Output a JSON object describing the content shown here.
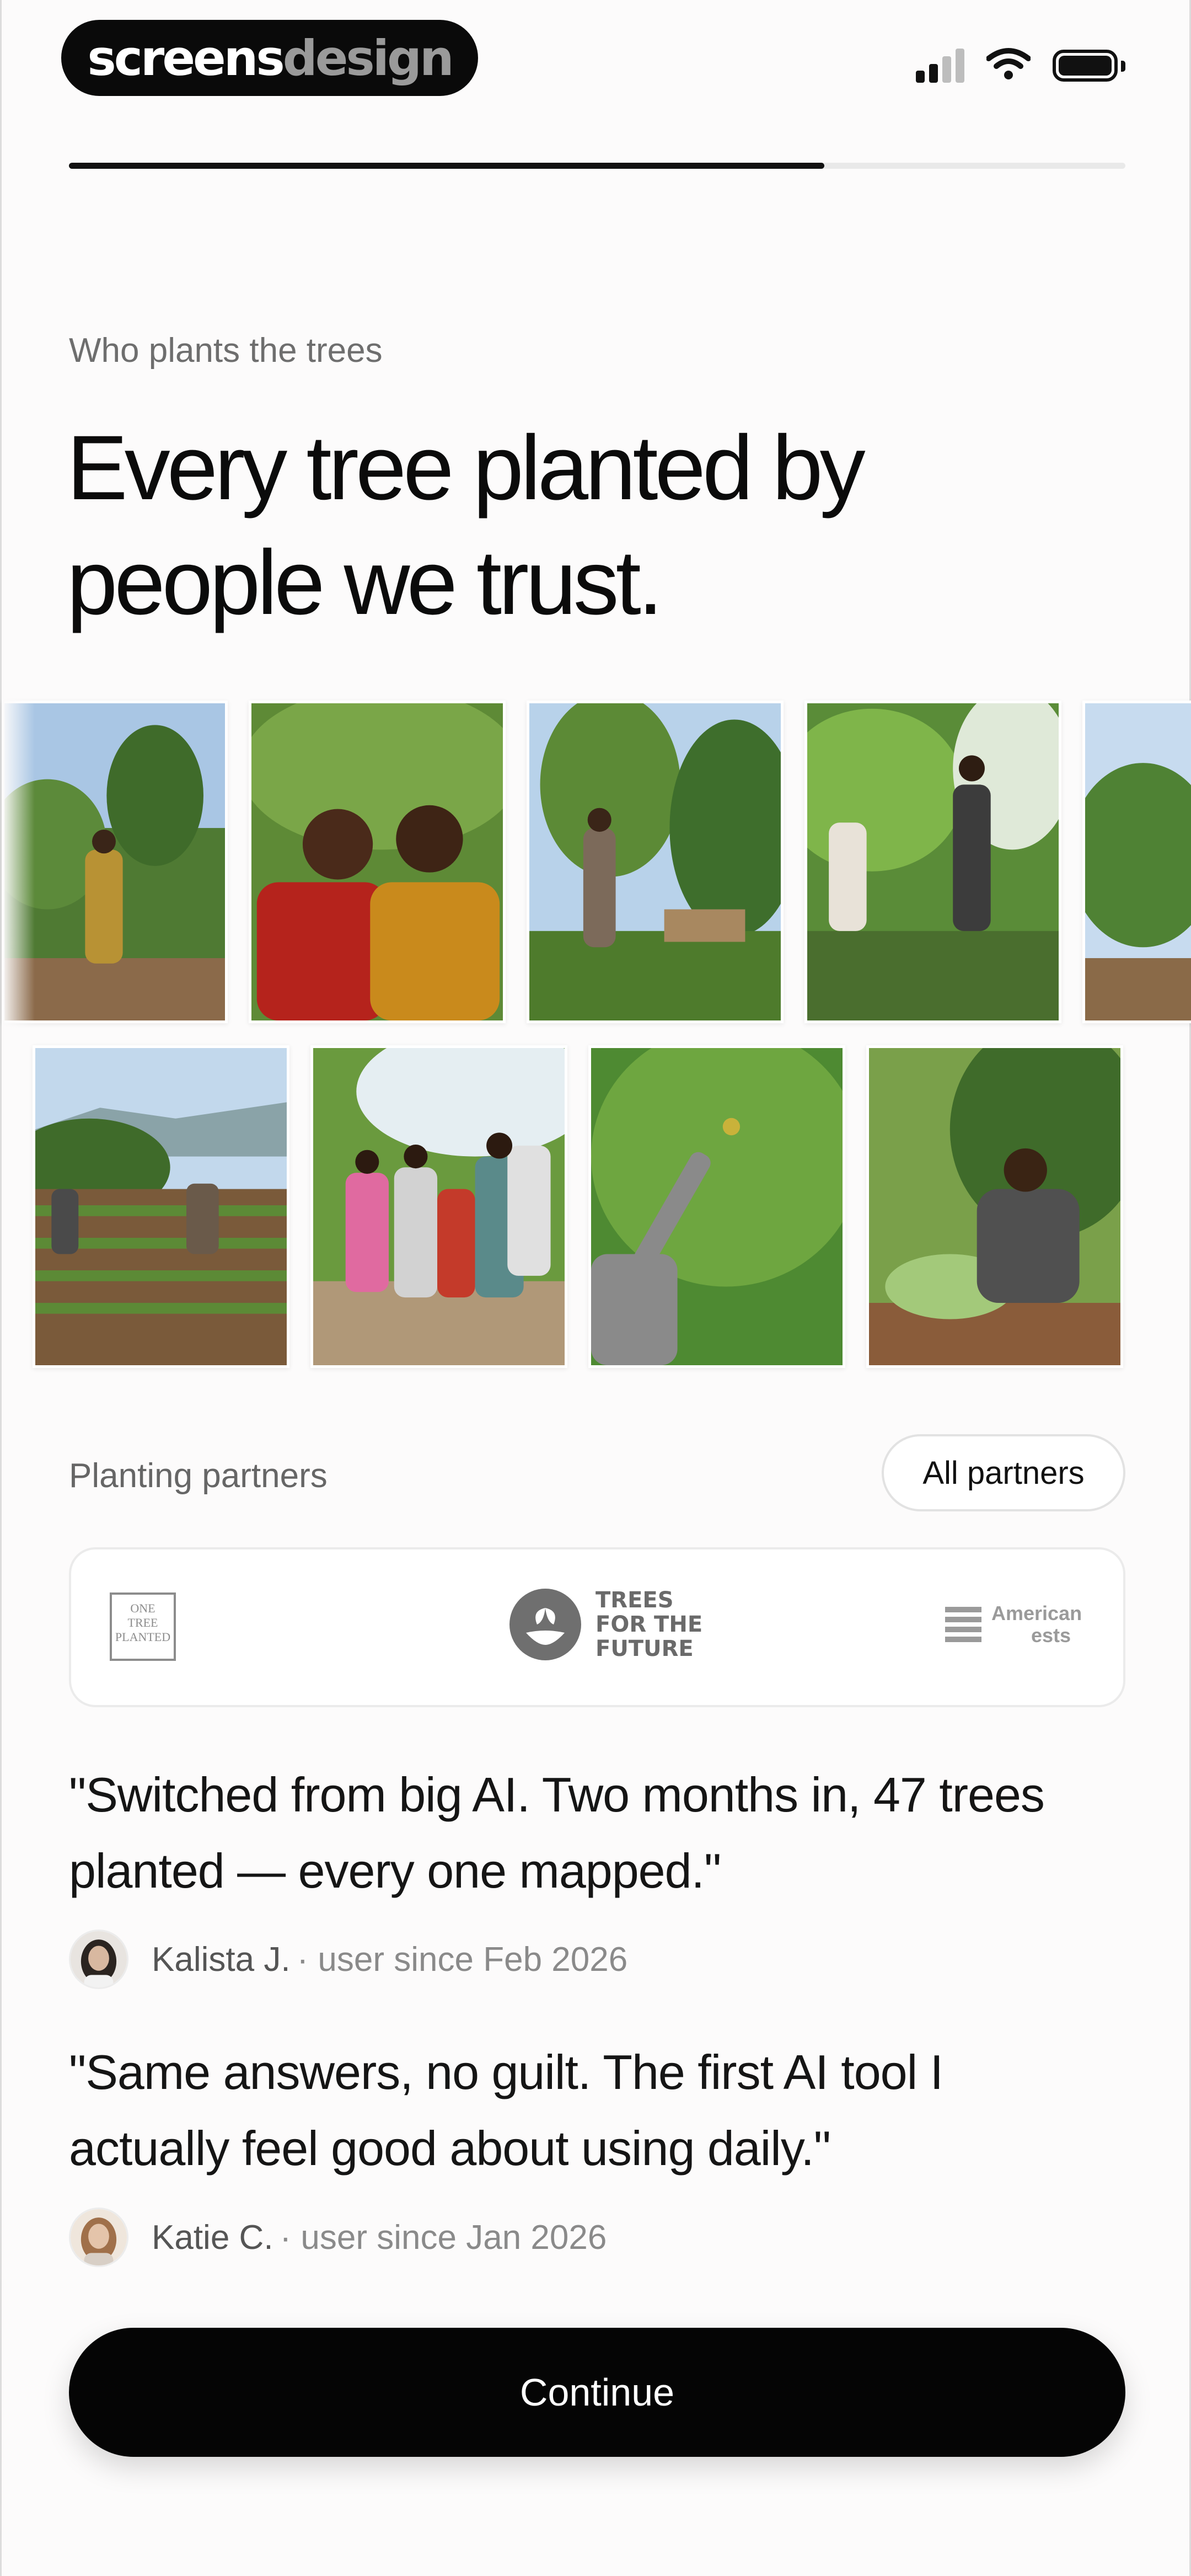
{
  "brand": {
    "logo_part1": "screens",
    "logo_part2": "design"
  },
  "status_bar": {
    "signal_icon": "signal-bars-icon",
    "wifi_icon": "wifi-icon",
    "battery_icon": "battery-icon"
  },
  "progress": {
    "fraction": 0.715
  },
  "eyebrow": "Who plants the trees",
  "headline": {
    "line1": "Every tree planted by",
    "line2": "people we trust."
  },
  "photos": [
    "woman-in-dress-field-photo",
    "smiling-couple-photo",
    "man-at-nursery-photo",
    "people-under-banana-tree-photo",
    "farmers-planting-rows-photo",
    "family-group-photo",
    "man-picking-fruit-photo",
    "man-tending-plant-photo"
  ],
  "partners": {
    "label": "Planting partners",
    "all_button": "All partners",
    "one_tree_planted": {
      "line1": "ONE",
      "line2": "TREE",
      "line3": "PLANTED"
    },
    "trees_for_the_future": {
      "line1": "TREES",
      "line2": "FOR THE",
      "line3": "FUTURE"
    },
    "american_forests": {
      "line1": "American",
      "line2": "ests"
    }
  },
  "testimonials": [
    {
      "quote_line1": "\"Switched from big AI. Two months in, 47 trees",
      "quote_line2": "planted — every one mapped.\"",
      "name": "Kalista J.",
      "meta": "· user since Feb 2026"
    },
    {
      "quote_line1": "\"Same answers, no guilt. The first AI tool I",
      "quote_line2": "actually feel good about using daily.\"",
      "name": "Katie C.",
      "meta": "· user since Jan 2026"
    }
  ],
  "cta": {
    "label": "Continue"
  },
  "colors": {
    "background": "#fcfbfb",
    "primary": "#050505",
    "muted": "#6e6e6e"
  }
}
